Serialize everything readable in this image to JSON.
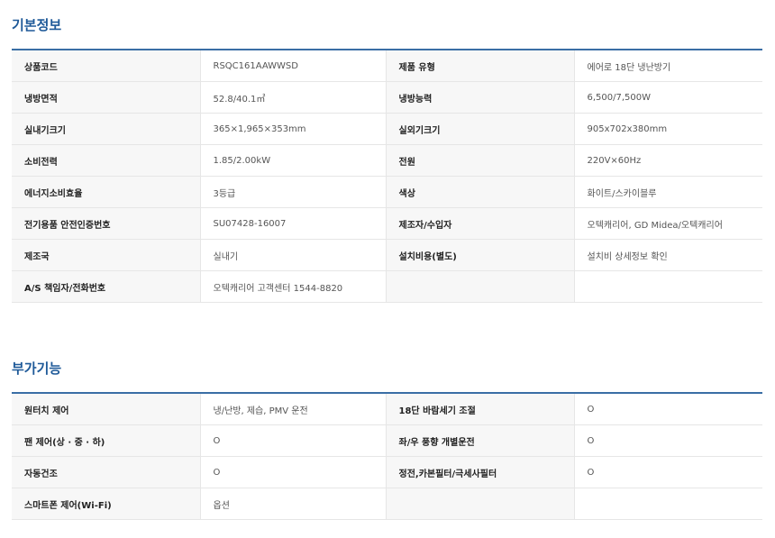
{
  "basic": {
    "title": "기본정보",
    "rows": [
      {
        "k1": "상품코드",
        "v1": "RSQC161AAWWSD",
        "k2": "제품 유형",
        "v2": "에어로 18단 냉난방기"
      },
      {
        "k1": "냉방면적",
        "v1": "52.8/40.1㎡",
        "k2": "냉방능력",
        "v2": "6,500/7,500W"
      },
      {
        "k1": "실내기크기",
        "v1": "365×1,965×353mm",
        "k2": "실외기크기",
        "v2": "905x702x380mm"
      },
      {
        "k1": "소비전력",
        "v1": "1.85/2.00kW",
        "k2": "전원",
        "v2": "220V×60Hz"
      },
      {
        "k1": "에너지소비효율",
        "v1": "3등급",
        "k2": "색상",
        "v2": "화이트/스카이블루"
      },
      {
        "k1": "전기용품 안전인증번호",
        "v1": "SU07428-16007",
        "k2": "제조자/수입자",
        "v2": "오텍캐리어, GD Midea/오텍캐리어"
      },
      {
        "k1": "제조국",
        "v1": "실내기",
        "k2": "설치비용(별도)",
        "v2": "설치비 상세정보 확인"
      },
      {
        "k1": "A/S 책임자/전화번호",
        "v1": "오텍캐리어 고객센터 1544-8820",
        "k2": "",
        "v2": ""
      }
    ]
  },
  "extra": {
    "title": "부가기능",
    "rows": [
      {
        "k1": "원터치 제어",
        "v1": "냉/난방, 제습, PMV 운전",
        "k2": "18단 바람세기 조절",
        "v2": "O"
      },
      {
        "k1": "팬 제어(상 · 중 · 하)",
        "v1": "O",
        "k2": "좌/우 풍향 개별운전",
        "v2": "O"
      },
      {
        "k1": "자동건조",
        "v1": "O",
        "k2": "정전,카본필터/극세사필터",
        "v2": "O"
      },
      {
        "k1": "스마트폰 제어(Wi-Fi)",
        "v1": "옵션",
        "k2": "",
        "v2": ""
      }
    ]
  }
}
